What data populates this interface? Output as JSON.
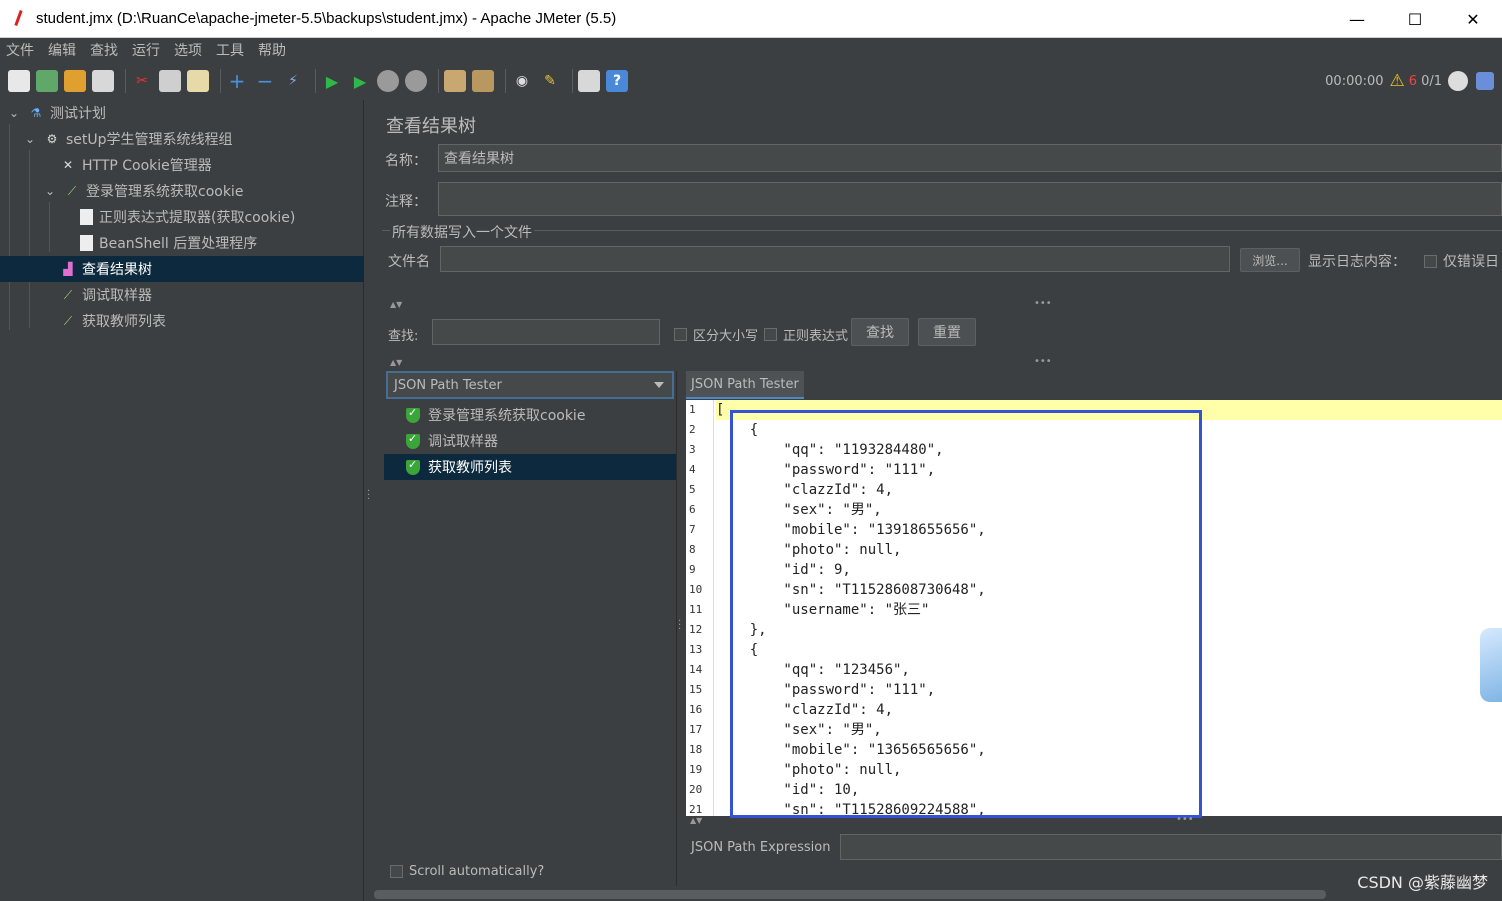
{
  "window": {
    "title": "student.jmx (D:\\RuanCe\\apache-jmeter-5.5\\backups\\student.jmx) - Apache JMeter (5.5)",
    "minimize": "—",
    "maximize": "☐",
    "close": "✕"
  },
  "menu": [
    "文件",
    "编辑",
    "查找",
    "运行",
    "选项",
    "工具",
    "帮助"
  ],
  "toolbar": {
    "elapsed": "00:00:00",
    "warnings": "6",
    "threads": "0/1"
  },
  "tree": {
    "items": [
      {
        "label": "测试计划",
        "icon": "flask-icon"
      },
      {
        "label": "setUp学生管理系统线程组",
        "icon": "gear-icon"
      },
      {
        "label": "HTTP Cookie管理器",
        "icon": "wrench-icon"
      },
      {
        "label": "登录管理系统获取cookie",
        "icon": "pipette-icon"
      },
      {
        "label": "正则表达式提取器(获取cookie)",
        "icon": "document-icon"
      },
      {
        "label": "BeanShell 后置处理程序",
        "icon": "document-icon"
      },
      {
        "label": "查看结果树",
        "icon": "chart-icon"
      },
      {
        "label": "调试取样器",
        "icon": "pipette-icon"
      },
      {
        "label": "获取教师列表",
        "icon": "pipette-icon"
      }
    ]
  },
  "panel": {
    "title": "查看结果树",
    "name_label": "名称：",
    "name_value": "查看结果树",
    "comment_label": "注释：",
    "comment_value": "",
    "file_group": "所有数据写入一个文件",
    "file_label": "文件名",
    "file_value": "",
    "browse": "浏览...",
    "log_label": "显示日志内容：",
    "errors_only": "仅错误日",
    "search_label": "查找:",
    "search_value": "",
    "case_sensitive": "区分大小写",
    "regex": "正则表达式",
    "find_button": "查找",
    "reset_button": "重置"
  },
  "results": {
    "renderer": "JSON Path Tester",
    "items": [
      "登录管理系统获取cookie",
      "调试取样器",
      "获取教师列表"
    ],
    "selected_index": 2,
    "scroll_auto": "Scroll automatically?"
  },
  "viewer": {
    "tab": "JSON Path Tester",
    "line_numbers": [
      "1",
      "2",
      "3",
      "4",
      "5",
      "6",
      "7",
      "8",
      "9",
      "10",
      "11",
      "12",
      "13",
      "14",
      "15",
      "16",
      "17",
      "18",
      "19",
      "20",
      "21"
    ],
    "lines": [
      "[",
      "    {",
      "        \"qq\": \"1193284480\",",
      "        \"password\": \"111\",",
      "        \"clazzId\": 4,",
      "        \"sex\": \"男\",",
      "        \"mobile\": \"13918655656\",",
      "        \"photo\": null,",
      "        \"id\": 9,",
      "        \"sn\": \"T11528608730648\",",
      "        \"username\": \"张三\"",
      "    },",
      "    {",
      "        \"qq\": \"123456\",",
      "        \"password\": \"111\",",
      "        \"clazzId\": 4,",
      "        \"sex\": \"男\",",
      "        \"mobile\": \"13656565656\",",
      "        \"photo\": null,",
      "        \"id\": 10,",
      "        \"sn\": \"T11528609224588\","
    ],
    "expression_label": "JSON Path Expression",
    "expression_value": ""
  },
  "watermark": "CSDN @紫藤幽梦",
  "colors": {
    "background": "#3c3f41",
    "selection": "#0d293e",
    "highlight_box": "#3552d4",
    "current_line": "#ffffaa"
  }
}
